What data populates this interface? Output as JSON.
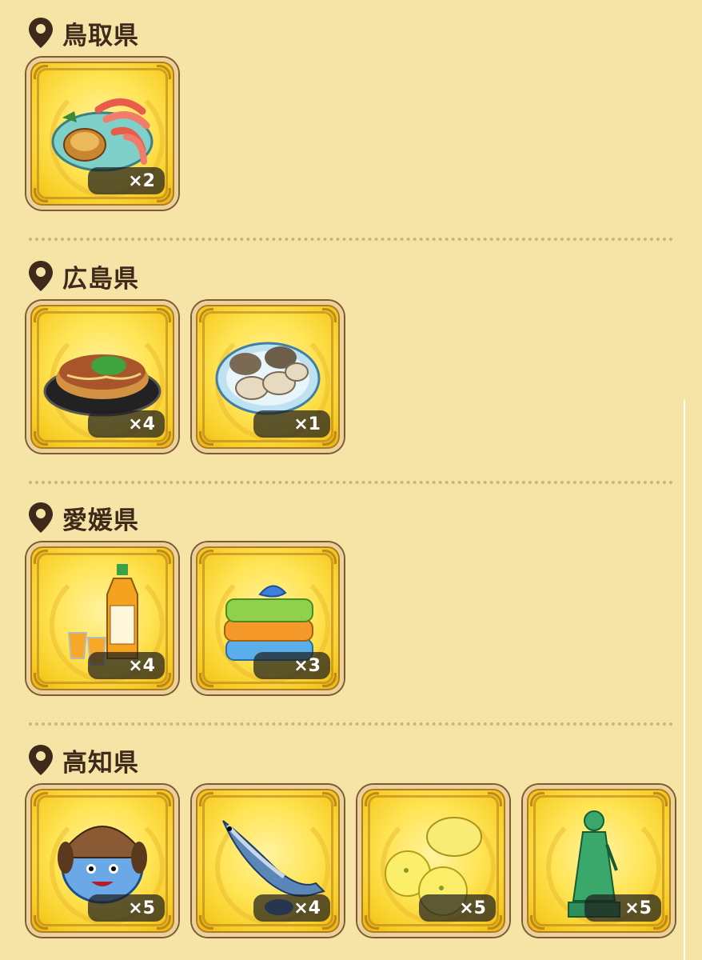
{
  "sections": [
    {
      "prefecture": "鳥取県",
      "items": [
        {
          "icon": "crab-platter-icon",
          "count": "×2"
        }
      ]
    },
    {
      "prefecture": "広島県",
      "items": [
        {
          "icon": "okonomiyaki-icon",
          "count": "×4"
        },
        {
          "icon": "oysters-icon",
          "count": "×1"
        }
      ]
    },
    {
      "prefecture": "愛媛県",
      "items": [
        {
          "icon": "mikan-juice-icon",
          "count": "×4"
        },
        {
          "icon": "towels-icon",
          "count": "×3"
        }
      ]
    },
    {
      "prefecture": "高知県",
      "items": [
        {
          "icon": "tosa-dog-slime-icon",
          "count": "×5"
        },
        {
          "icon": "bonito-icon",
          "count": "×4"
        },
        {
          "icon": "yuzu-icon",
          "count": "×5"
        },
        {
          "icon": "ryoma-statue-icon",
          "count": "×5"
        }
      ]
    }
  ]
}
